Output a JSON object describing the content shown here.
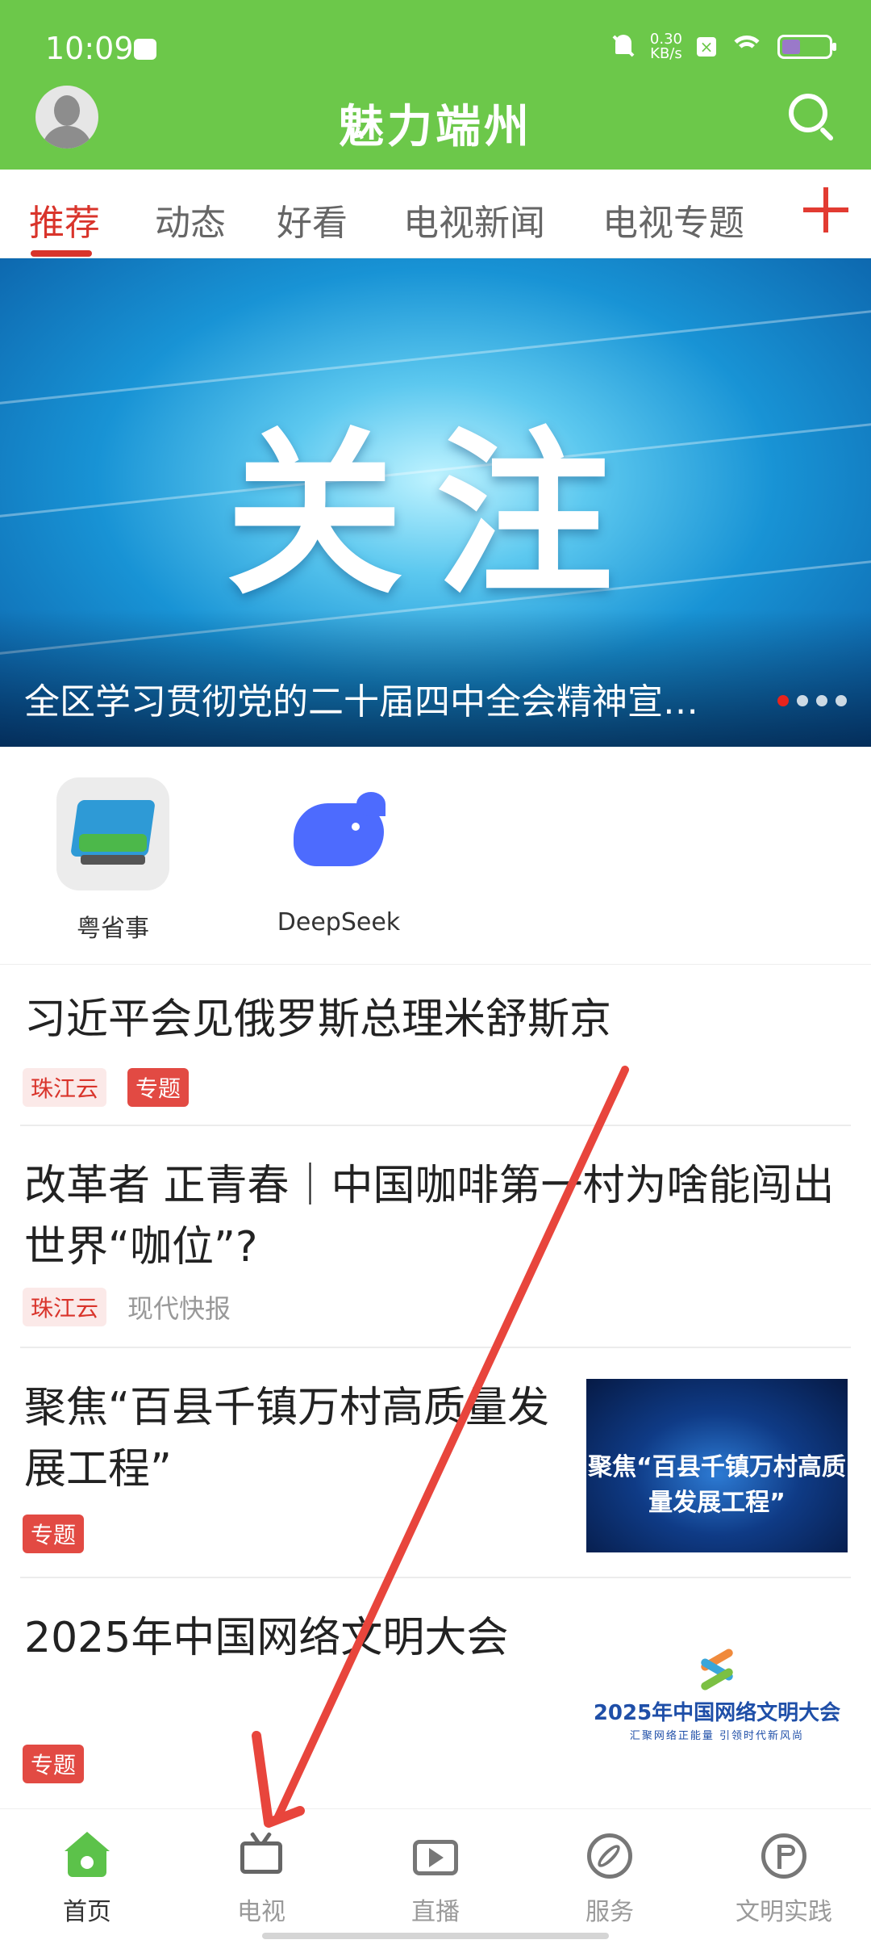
{
  "status_bar": {
    "time": "10:09",
    "net_speed_value": "0.30",
    "net_speed_unit": "KB/s",
    "battery_color": "#9a79c9"
  },
  "header": {
    "title": "魅力端州",
    "bg_color": "#6cc84a",
    "avatar_icon": "user-avatar",
    "search_icon": "search-icon"
  },
  "tabs": {
    "items": [
      "推荐",
      "动态",
      "好看",
      "电视新闻",
      "电视专题"
    ],
    "active_index": 0,
    "active_color": "#d9342b",
    "add_icon": "plus-icon"
  },
  "banner": {
    "image_text": "关注",
    "caption": "全区学习贯彻党的二十届四中全会精神宣…",
    "slide_count": 4,
    "active_slide": 0
  },
  "quick_apps": [
    {
      "label": "粤省事",
      "icon": "yueshengshi-app-icon"
    },
    {
      "label": "DeepSeek",
      "icon": "deepseek-whale-icon"
    }
  ],
  "news": [
    {
      "title": "习近平会见俄罗斯总理米舒斯京",
      "tags": [
        "珠江云",
        "专题"
      ]
    },
    {
      "title_line1": "改革者 正青春｜中国咖啡第一村为啥能闯出",
      "title_line2": "世界“咖位”?",
      "tags": [
        "珠江云",
        "现代快报"
      ]
    },
    {
      "title_line1": "聚焦“百县千镇万村高质量发",
      "title_line2": "展工程”",
      "tags": [
        "专题"
      ],
      "thumb_text": "聚焦“百县千镇万村高质量发展工程”"
    },
    {
      "title": "2025年中国网络文明大会",
      "tags": [
        "专题"
      ],
      "thumb_title": "2025年中国网络文明大会",
      "thumb_subtitle": "汇聚网络正能量  引领时代新风尚"
    }
  ],
  "bottom_nav": [
    {
      "label": "首页",
      "icon": "home-icon",
      "active": true
    },
    {
      "label": "电视",
      "icon": "tv-icon",
      "active": false
    },
    {
      "label": "直播",
      "icon": "live-video-icon",
      "active": false
    },
    {
      "label": "服务",
      "icon": "compass-icon",
      "active": false
    },
    {
      "label": "文明实践",
      "icon": "flag-icon",
      "active": false
    }
  ],
  "annotation": {
    "type": "arrow",
    "color": "#e8453c",
    "points_to": "电视"
  }
}
